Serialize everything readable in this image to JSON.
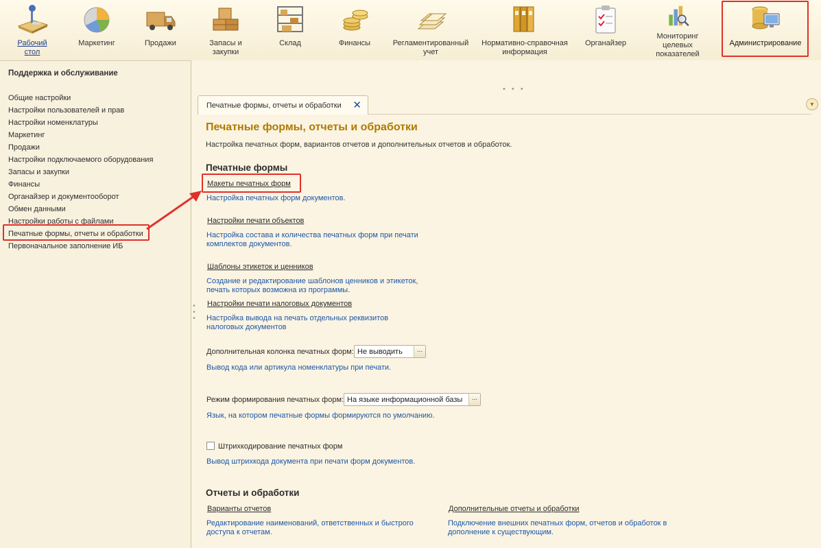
{
  "sections": [
    {
      "id": "desktop",
      "label": "Рабочий стол",
      "icon": "desktop-icon"
    },
    {
      "id": "marketing",
      "label": "Маркетинг",
      "icon": "pie-chart-icon"
    },
    {
      "id": "sales",
      "label": "Продажи",
      "icon": "truck-icon"
    },
    {
      "id": "stock",
      "label": "Запасы и закупки",
      "icon": "boxes-icon"
    },
    {
      "id": "warehouse",
      "label": "Склад",
      "icon": "shelf-icon"
    },
    {
      "id": "finance",
      "label": "Финансы",
      "icon": "coins-icon"
    },
    {
      "id": "regulated",
      "label": "Регламентированный учет",
      "icon": "binders-icon"
    },
    {
      "id": "reference",
      "label": "Нормативно-справочная информация",
      "icon": "folders-icon"
    },
    {
      "id": "organizer",
      "label": "Органайзер",
      "icon": "clipboard-icon"
    },
    {
      "id": "monitoring",
      "label": "Мониторинг целевых показателей",
      "icon": "magnifier-chart-icon"
    },
    {
      "id": "admin",
      "label": "Администрирование",
      "icon": "database-monitor-icon"
    }
  ],
  "left_panel": {
    "title": "Поддержка и обслуживание",
    "items": [
      "Общие настройки",
      "Настройки пользователей и прав",
      "Настройки номенклатуры",
      "Маркетинг",
      "Продажи",
      "Настройки подключаемого оборудования",
      "Запасы и закупки",
      "Финансы",
      "Органайзер и документооборот",
      "Обмен данными",
      "Настройки работы с файлами",
      "Печатные формы, отчеты и обработки",
      "Первоначальное заполнение ИБ"
    ]
  },
  "tab": {
    "label": "Печатные формы, отчеты и обработки",
    "close": "✕"
  },
  "page": {
    "title": "Печатные формы, отчеты и обработки",
    "description": "Настройка печатных форм, вариантов отчетов и дополнительных отчетов и обработок.",
    "print_forms": {
      "heading": "Печатные формы",
      "layouts": {
        "cmd": "Макеты печатных форм",
        "note": "Настройка печатных форм документов."
      },
      "print_settings": {
        "cmd": "Настройки печати объектов",
        "note": "Настройка состава и количества печатных форм при печати комплектов документов."
      },
      "label_templates": {
        "cmd": "Шаблоны этикеток и ценников",
        "note": "Создание и редактирование шаблонов ценников и этикеток, печать которых возможна из программы."
      },
      "tax_docs": {
        "cmd": "Настройки печати налоговых документов",
        "note": "Настройка вывода на печать отдельных реквизитов налоговых документов"
      },
      "extra_column": {
        "label": "Дополнительная колонка печатных форм:",
        "value": "Не выводить",
        "note": "Вывод кода или артикула номенклатуры при печати."
      },
      "mode": {
        "label": "Режим формирования печатных форм:",
        "value": "На языке информационной базы",
        "note": "Язык, на котором печатные формы формируются по умолчанию."
      },
      "barcode": {
        "label": "Штрихкодирование печатных форм",
        "checked": false,
        "note": "Вывод штрихкода документа при печати форм документов."
      }
    },
    "reports": {
      "heading": "Отчеты и обработки",
      "variants": {
        "cmd": "Варианты отчетов",
        "note": "Редактирование наименований, ответственных и быстрого доступа к отчетам."
      },
      "additional": {
        "cmd": "Дополнительные отчеты и обработки",
        "note": "Подключение внешних печатных форм, отчетов и обработок в дополнение к существующим."
      }
    }
  },
  "colors": {
    "accent": "#b07a00",
    "link": "#1c56a8",
    "highlight": "#e0302a"
  },
  "select_button": "..."
}
